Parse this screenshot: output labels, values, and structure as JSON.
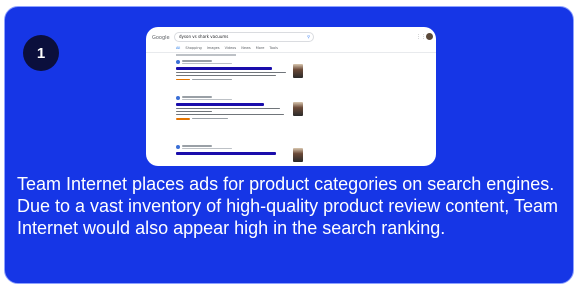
{
  "step": {
    "number": "1"
  },
  "screenshot": {
    "logo": "Google",
    "query": "dyson vs shark vacuums",
    "tabs": [
      "All",
      "Shopping",
      "Images",
      "Videos",
      "News",
      "More",
      "Tools"
    ],
    "active_tab": "All"
  },
  "description": "Team Internet places ads for product categories on search engines. Due to a vast inventory of high-quality product review content, Team Internet would also appear high in the search ranking.",
  "colors": {
    "card_background": "#1636e6",
    "badge_background": "#0b0f3c",
    "link_blue": "#1a0dab"
  }
}
